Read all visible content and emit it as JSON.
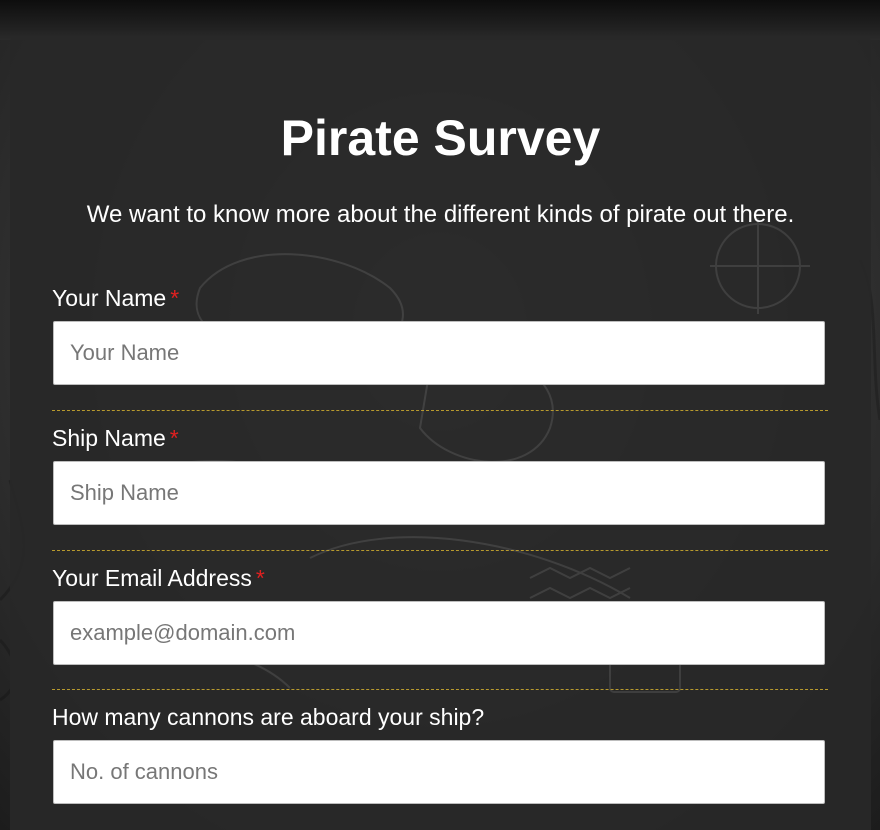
{
  "form": {
    "title": "Pirate Survey",
    "description": "We want to know more about the different kinds of pirate out there.",
    "required_marker": "*",
    "fields": [
      {
        "label": "Your Name",
        "placeholder": "Your Name",
        "value": ""
      },
      {
        "label": "Ship Name",
        "placeholder": "Ship Name",
        "value": ""
      },
      {
        "label": "Your Email Address",
        "placeholder": "example@domain.com",
        "value": ""
      },
      {
        "label": "How many cannons are aboard your ship?",
        "placeholder": "No. of cannons",
        "value": ""
      }
    ]
  },
  "colors": {
    "panel": "#282828",
    "text": "#ffffff",
    "required": "#e02020",
    "divider": "#b89a2e"
  }
}
